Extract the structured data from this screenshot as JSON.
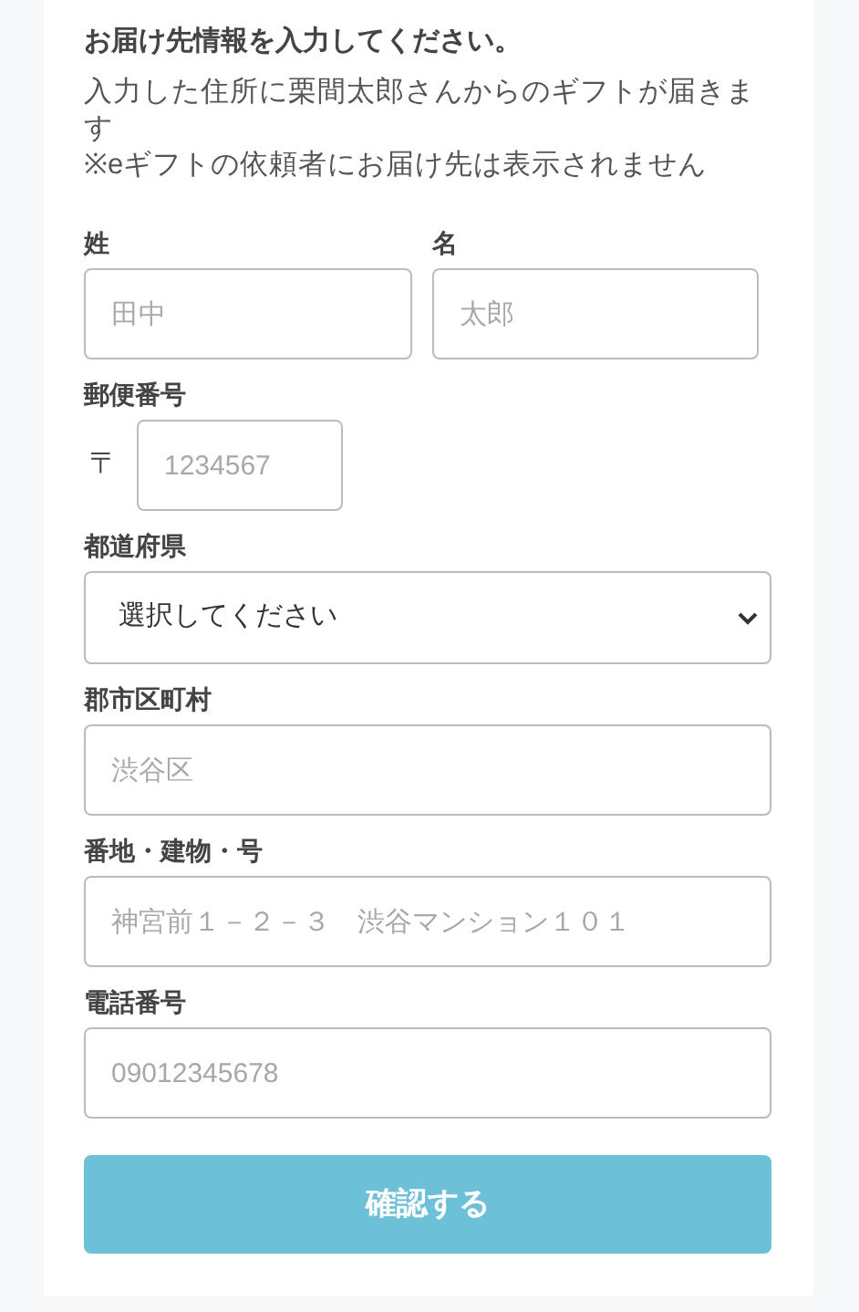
{
  "heading": "お届け先情報を入力してください。",
  "description": "入力した住所に栗間太郎さんからのギフトが届きます",
  "notice": "※eギフトの依頼者にお届け先は表示されません",
  "fields": [
    {
      "kind": "pair",
      "items": [
        {
          "label": "姓",
          "placeholder": "田中"
        },
        {
          "label": "名",
          "placeholder": "太郎"
        }
      ]
    },
    {
      "kind": "postal",
      "label": "郵便番号",
      "prefix": "〒",
      "placeholder": "1234567"
    },
    {
      "kind": "select",
      "label": "都道府県",
      "value": "選択してください"
    },
    {
      "kind": "text",
      "label": "郡市区町村",
      "placeholder": "渋谷区"
    },
    {
      "kind": "text",
      "label": "番地・建物・号",
      "placeholder": "神宮前１－２－３　渋谷マンション１０１"
    },
    {
      "kind": "text",
      "label": "電話番号",
      "placeholder": "09012345678"
    }
  ],
  "submit_button": "確認する"
}
